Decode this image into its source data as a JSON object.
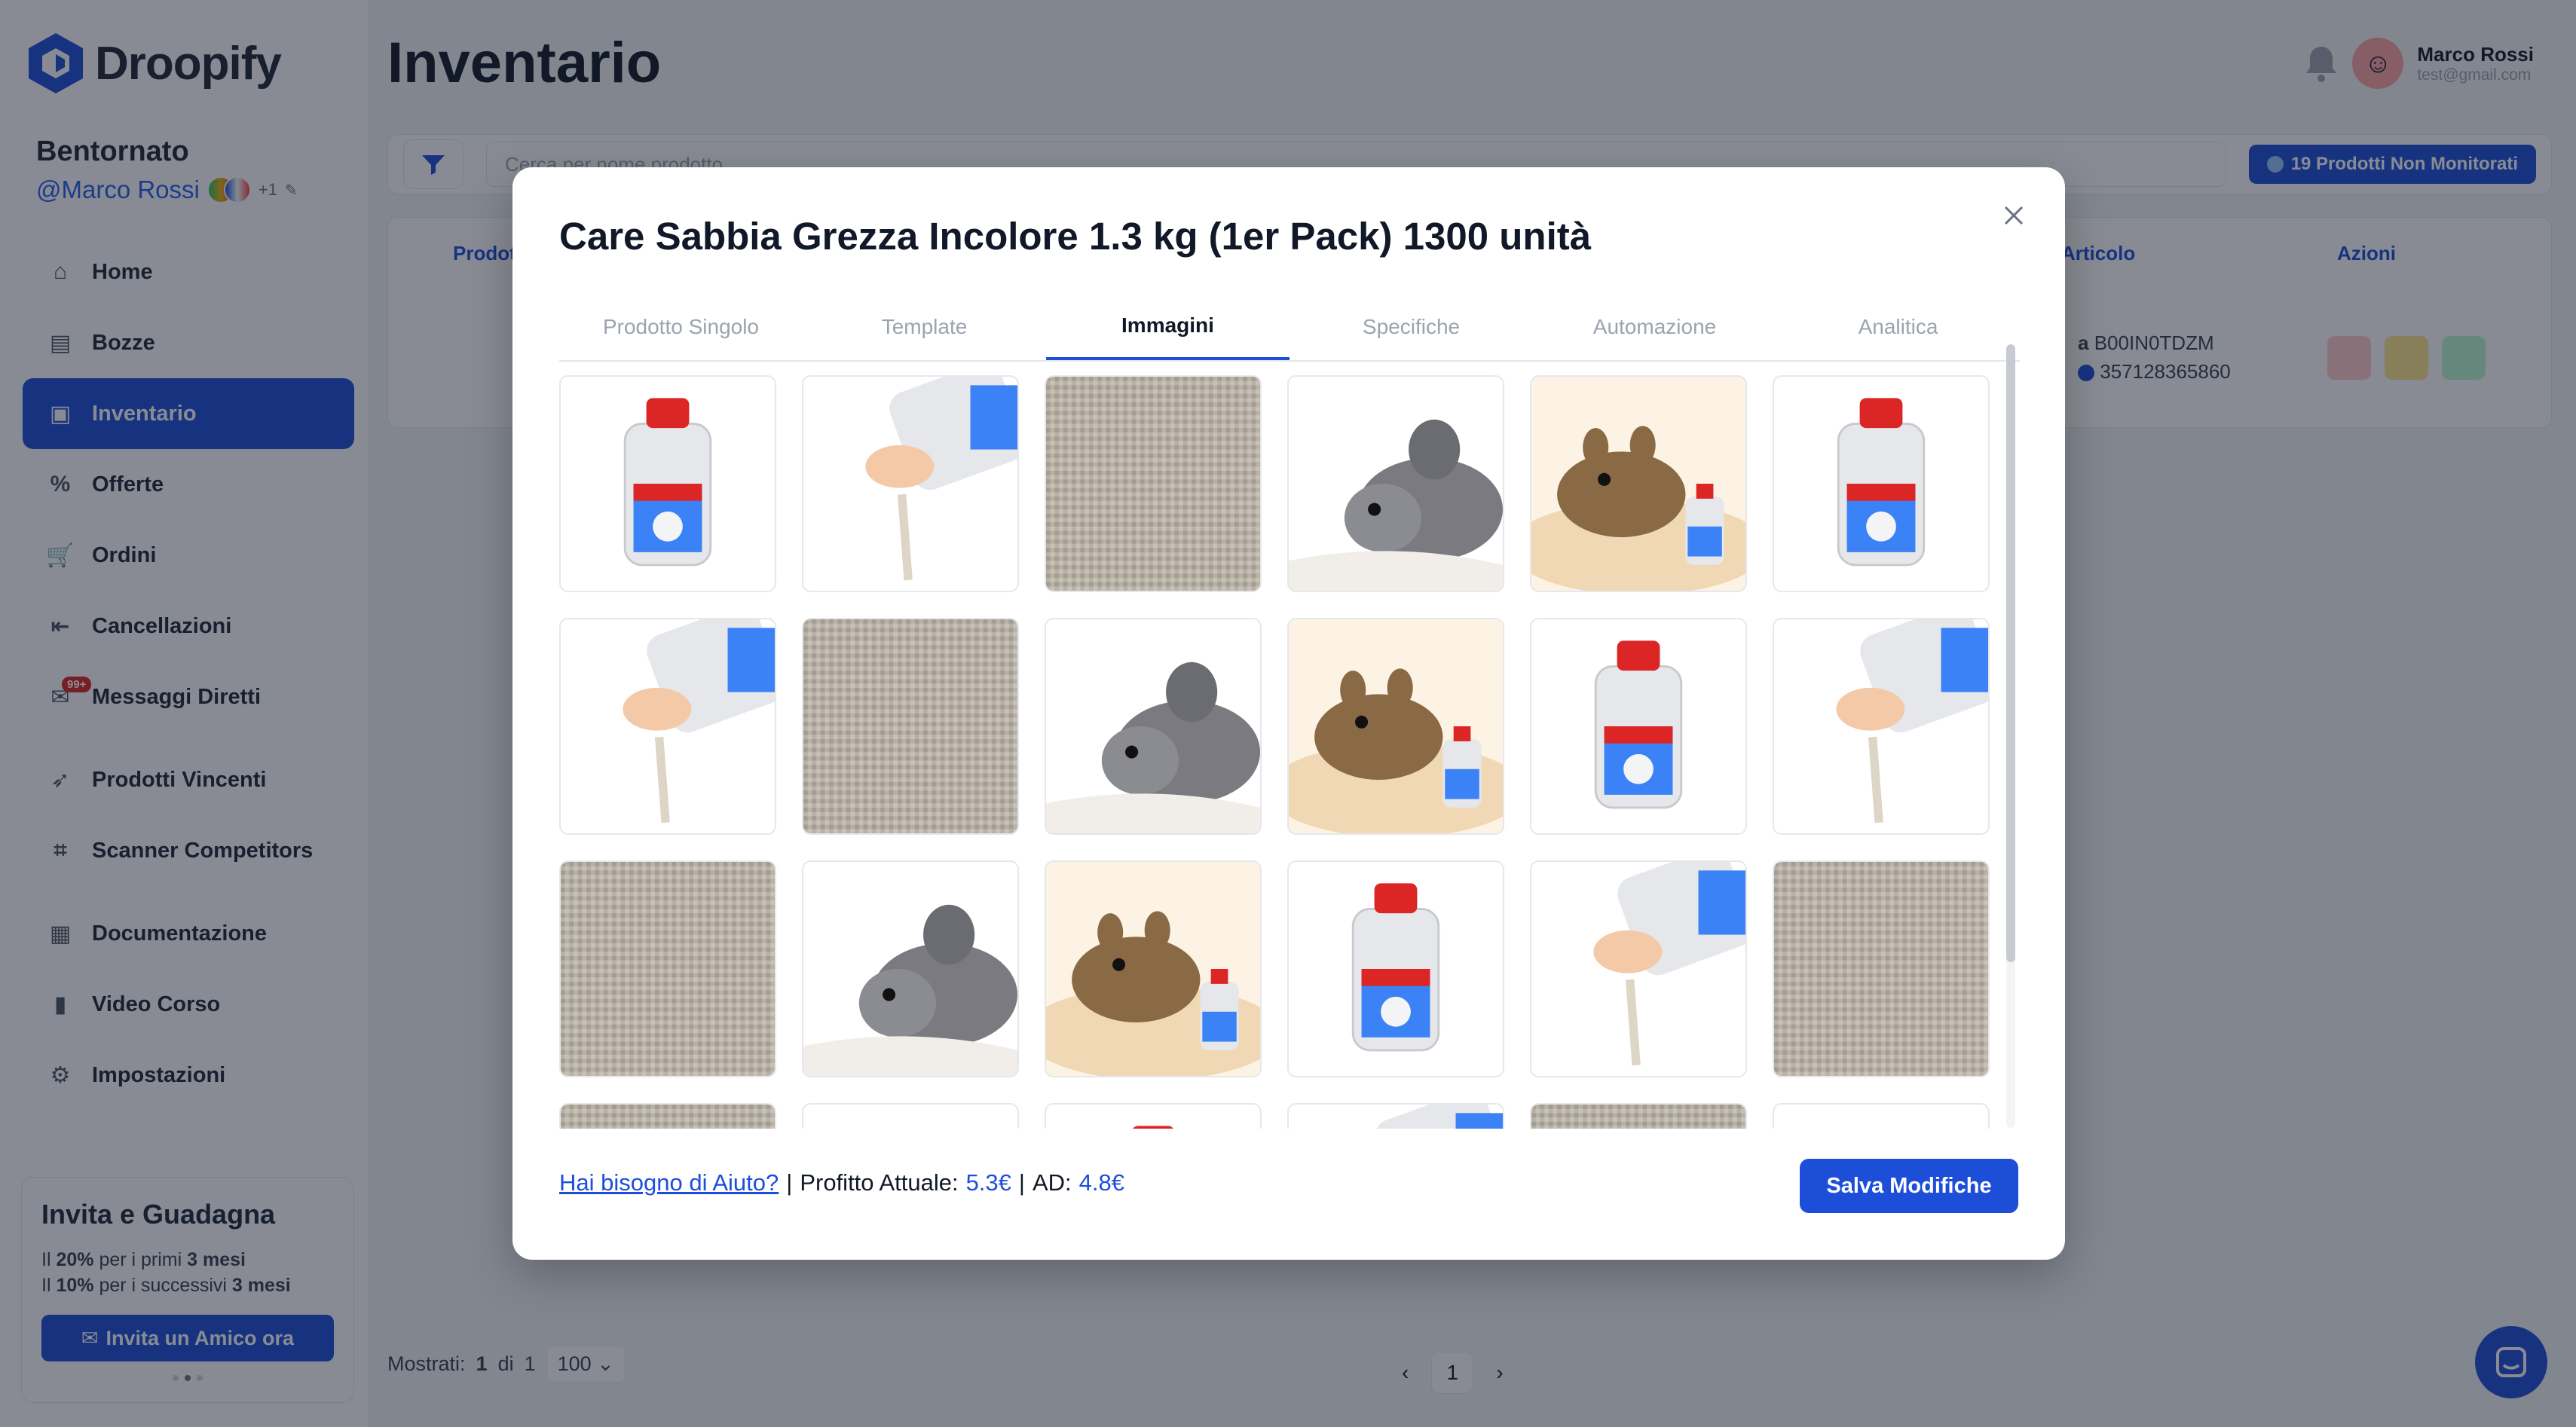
{
  "app": {
    "name": "Droopify"
  },
  "sidebar": {
    "welcome": "Bentornato",
    "username": "@Marco Rossi",
    "extra_count": "+1",
    "items": [
      {
        "label": "Home",
        "icon": "home-icon"
      },
      {
        "label": "Bozze",
        "icon": "drafts-icon"
      },
      {
        "label": "Inventario",
        "icon": "inventory-icon",
        "active": true
      },
      {
        "label": "Offerte",
        "icon": "offers-icon"
      },
      {
        "label": "Ordini",
        "icon": "cart-icon"
      },
      {
        "label": "Cancellazioni",
        "icon": "cancel-icon"
      },
      {
        "label": "Messaggi Diretti",
        "icon": "message-icon",
        "badge": "99+"
      },
      {
        "label": "Prodotti Vincenti",
        "icon": "rocket-icon"
      },
      {
        "label": "Scanner Competitors",
        "icon": "scanner-icon"
      },
      {
        "label": "Documentazione",
        "icon": "document-icon"
      },
      {
        "label": "Video Corso",
        "icon": "book-icon"
      },
      {
        "label": "Impostazioni",
        "icon": "gear-icon"
      }
    ],
    "invite": {
      "title": "Invita e Guadagna",
      "line1_pre": "Il ",
      "line1_pct": "20%",
      "line1_mid": " per i primi ",
      "line1_dur": "3 mesi",
      "line2_pre": "Il ",
      "line2_pct": "10%",
      "line2_mid": " per i successivi ",
      "line2_dur": "3 mesi",
      "button": "Invita un Amico ora"
    }
  },
  "header": {
    "title": "Inventario",
    "user_name": "Marco Rossi",
    "user_email": "test@gmail.com"
  },
  "toolbar": {
    "search_placeholder": "Cerca per nome prodotto",
    "unmonitored": "19 Prodotti Non Monitorati"
  },
  "table": {
    "headers": {
      "product": "Prodotto",
      "article": "Articolo",
      "actions": "Azioni"
    },
    "row": {
      "asin": "B00IN0TDZM",
      "ean": "357128365860"
    }
  },
  "pagination": {
    "shown_label": "Mostrati:",
    "shown_value": "1",
    "of_label": "di",
    "total": "1",
    "per_page": "100",
    "current_page": "1"
  },
  "modal": {
    "title": "Care Sabbia Grezza Incolore 1.3 kg (1er Pack) 1300 unità",
    "tabs": [
      "Prodotto Singolo",
      "Template",
      "Immagini",
      "Specifiche",
      "Automazione",
      "Analitica"
    ],
    "active_tab": "Immagini",
    "images": [
      "bottle",
      "hand-pour",
      "sand",
      "chinchilla",
      "degu",
      "bottle",
      "hand-pour",
      "sand",
      "chinchilla",
      "degu",
      "bottle",
      "hand-pour",
      "sand",
      "chinchilla",
      "degu",
      "bottle",
      "hand-pour",
      "sand",
      "sand",
      "chinchilla",
      "bottle",
      "hand-pour",
      "sand",
      "chinchilla"
    ],
    "footer": {
      "help": "Hai bisogno di Aiuto?",
      "sep": "|",
      "profit_label": "Profitto Attuale:",
      "profit_value": "5.3€",
      "ad_label": "AD:",
      "ad_value": "4.8€"
    },
    "save": "Salva Modifiche"
  },
  "colors": {
    "accent": "#1d4ed8",
    "overlay": "rgba(17,24,39,0.5)"
  }
}
